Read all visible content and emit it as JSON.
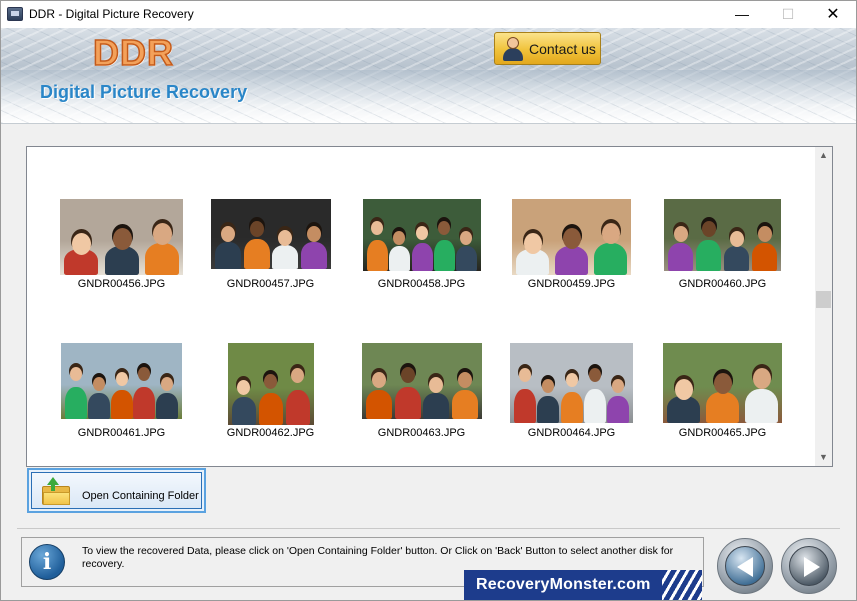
{
  "window": {
    "title": "DDR - Digital Picture Recovery",
    "minimize_glyph": "—",
    "maximize_glyph": "☐",
    "close_glyph": "✕"
  },
  "header": {
    "logo": "DDR",
    "subtitle": "Digital Picture Recovery",
    "contact_label": "Contact us"
  },
  "gallery": {
    "scroll_up_glyph": "▲",
    "scroll_down_glyph": "▼",
    "items": [
      {
        "filename": "GNDR00456.JPG",
        "bg": "#b3a79a",
        "ground": "#e7e1d6"
      },
      {
        "filename": "GNDR00457.JPG",
        "bg": "#2a2a2a",
        "ground": "#3b3b3b"
      },
      {
        "filename": "GNDR00458.JPG",
        "bg": "#3d5c3a",
        "ground": "#26241f"
      },
      {
        "filename": "GNDR00459.JPG",
        "bg": "#c9a27a",
        "ground": "#e8d9c4"
      },
      {
        "filename": "GNDR00460.JPG",
        "bg": "#5a6b45",
        "ground": "#9a8f80"
      },
      {
        "filename": "GNDR00461.JPG",
        "bg": "#9fb5c4",
        "ground": "#6a7d3a"
      },
      {
        "filename": "GNDR00462.JPG",
        "bg": "#6f8a46",
        "ground": "#5c4a35"
      },
      {
        "filename": "GNDR00463.JPG",
        "bg": "#6e8754",
        "ground": "#3c3a36"
      },
      {
        "filename": "GNDR00464.JPG",
        "bg": "#b8bec4",
        "ground": "#8b8f92"
      },
      {
        "filename": "GNDR00465.JPG",
        "bg": "#6f8c4f",
        "ground": "#8b5a3c"
      }
    ]
  },
  "actions": {
    "open_folder_label": "Open Containing Folder"
  },
  "info": {
    "message": "To view the recovered Data, please click on 'Open Containing Folder' button. Or Click on 'Back' Button to select another disk for recovery.",
    "brand": "RecoveryMonster.com"
  }
}
